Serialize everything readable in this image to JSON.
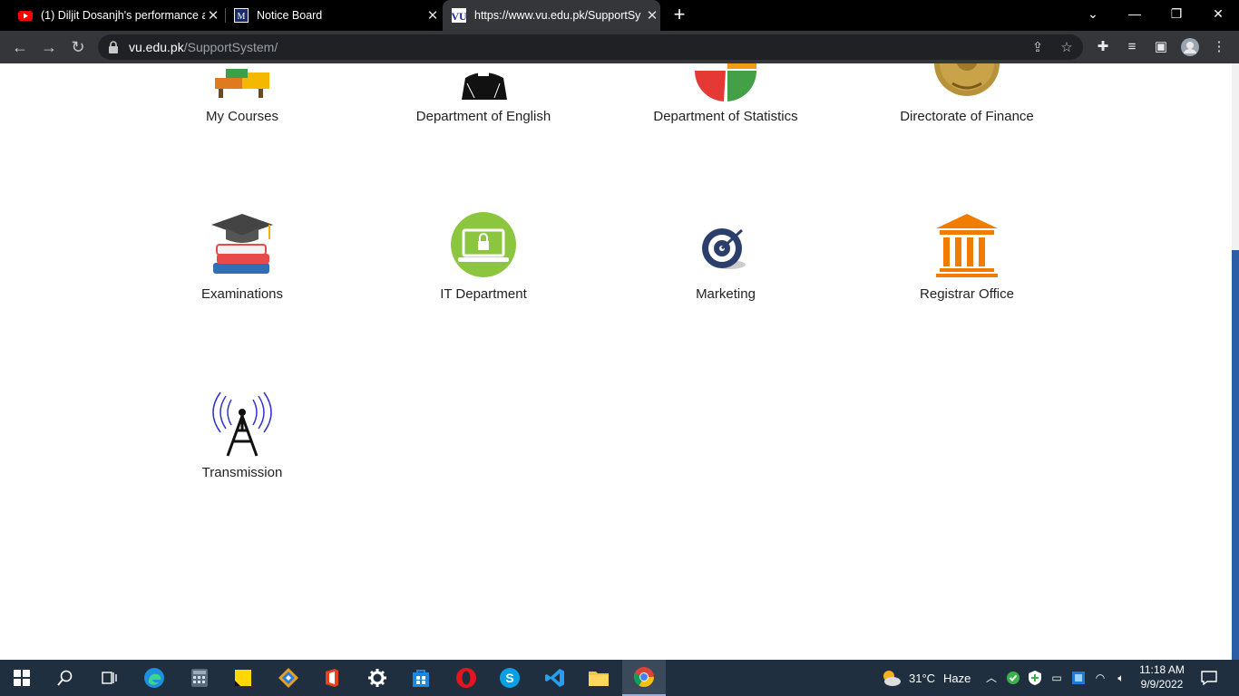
{
  "tabs": [
    {
      "title": "(1) Diljit Dosanjh's performance a",
      "favicon": "youtube-icon"
    },
    {
      "title": "Notice Board",
      "favicon": "vu-icon"
    },
    {
      "title": "https://www.vu.edu.pk/SupportSy",
      "favicon": "vu-icon",
      "active": true
    }
  ],
  "newtab_label": "+",
  "address": {
    "domain": "vu.edu.pk",
    "path": "/SupportSystem/"
  },
  "tiles": [
    {
      "label": "My Courses",
      "icon": "courses-icon"
    },
    {
      "label": "Department of English",
      "icon": "english-icon"
    },
    {
      "label": "Department of Statistics",
      "icon": "statistics-icon"
    },
    {
      "label": "Directorate of Finance",
      "icon": "finance-coin-icon"
    },
    {
      "label": "Examinations",
      "icon": "books-graduation-cap-icon"
    },
    {
      "label": "IT Department",
      "icon": "laptop-lock-icon"
    },
    {
      "label": "Marketing",
      "icon": "target-icon"
    },
    {
      "label": "Registrar Office",
      "icon": "building-icon"
    },
    {
      "label": "Transmission",
      "icon": "antenna-icon"
    }
  ],
  "taskbar": {
    "weather_temp": "31°C",
    "weather_desc": "Haze",
    "time": "11:18 AM",
    "date": "9/9/2022"
  },
  "colors": {
    "tab_bar": "#000000",
    "toolbar": "#35363a",
    "taskbar": "#1f2f3f",
    "scroll_thumb": "#2b5ea7"
  }
}
